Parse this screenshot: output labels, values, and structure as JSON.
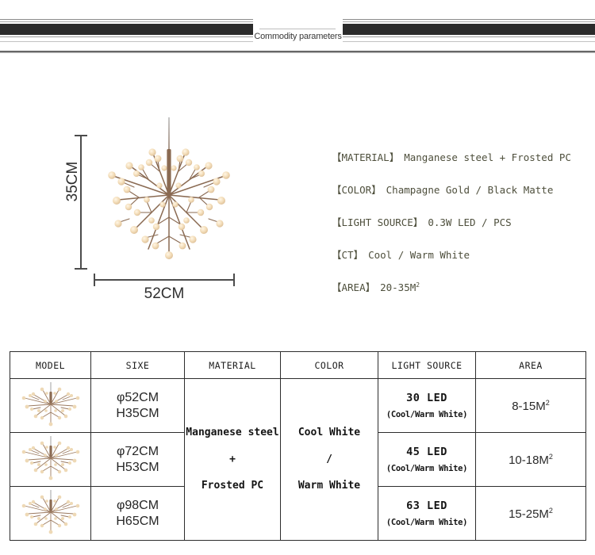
{
  "banner": {
    "label": "Commodity parameters"
  },
  "diagram": {
    "height_label": "35CM",
    "width_label": "52CM",
    "product_icon": "chandelier-icon"
  },
  "specs": [
    {
      "key": "【MATERIAL】",
      "value": "Manganese steel + Frosted PC"
    },
    {
      "key": "【COLOR】",
      "value": "Champagne Gold / Black Matte"
    },
    {
      "key": "【LIGHT SOURCE】",
      "value": "0.3W LED / PCS"
    },
    {
      "key": "【CT】",
      "value": "Cool / Warm White"
    },
    {
      "key": "【AREA】",
      "value": "20-35M",
      "sup": "2"
    }
  ],
  "table": {
    "headers": [
      "MODEL",
      "SIXE",
      "MATERIAL",
      "COLOR",
      "LIGHT SOURCE",
      "AREA"
    ],
    "material_merged": {
      "line1": "Manganese steel",
      "line2": "+",
      "line3": "Frosted PC"
    },
    "color_merged": {
      "line1": "Cool White",
      "line2": "/",
      "line3": "Warm White"
    },
    "rows": [
      {
        "model_icon": "chandelier-thumb-icon",
        "diameter": "φ52CM",
        "height": "H35CM",
        "led": "30 LED",
        "ct": "(Cool/Warm White)",
        "area": "8-15M",
        "area_sup": "2"
      },
      {
        "model_icon": "chandelier-thumb-icon",
        "diameter": "φ72CM",
        "height": "H53CM",
        "led": "45 LED",
        "ct": "(Cool/Warm White)",
        "area": "10-18M",
        "area_sup": "2"
      },
      {
        "model_icon": "chandelier-thumb-icon",
        "diameter": "φ98CM",
        "height": "H65CM",
        "led": "63 LED",
        "ct": "(Cool/Warm White)",
        "area": "15-25M",
        "area_sup": "2"
      }
    ]
  },
  "colors": {
    "bar_dark": "#2b2b2b",
    "spec_text": "#4e4f3c",
    "table_border": "#2d2d2d",
    "branch": "#8a6a52",
    "bulb": "#f2d9b0"
  }
}
